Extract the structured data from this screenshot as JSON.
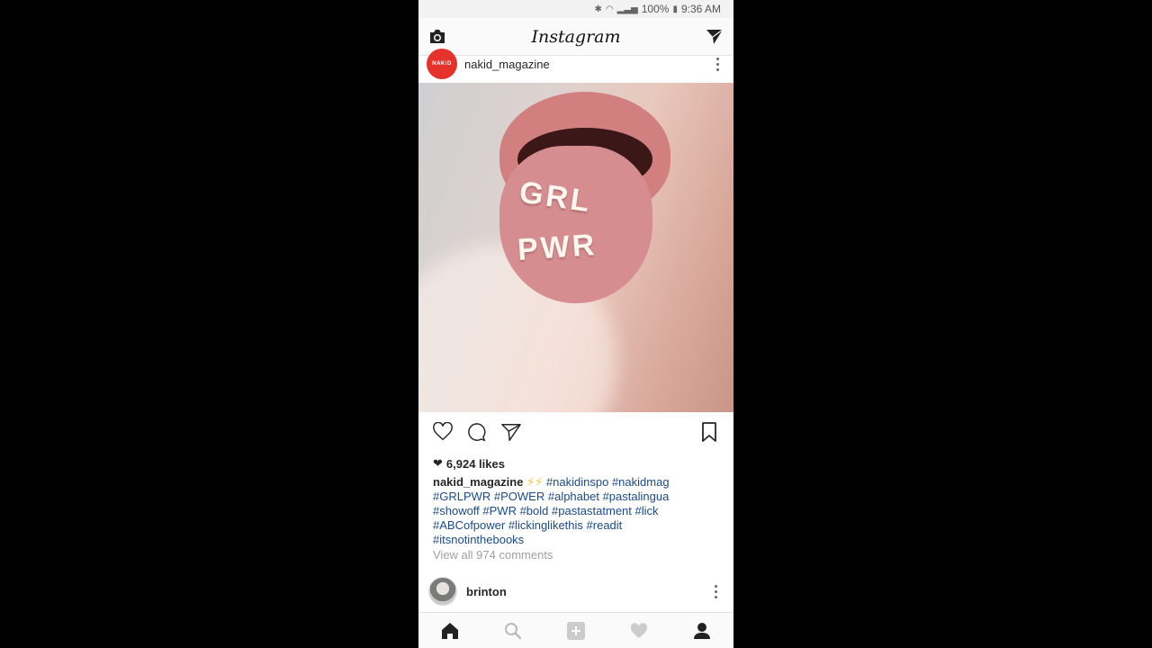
{
  "status_bar": {
    "battery": "100%",
    "time": "9:36 AM"
  },
  "app": {
    "title": "Instagram"
  },
  "post": {
    "username": "nakid_magazine",
    "avatar_text": "NAKID",
    "image_text_line1": "GRL",
    "image_text_line2": "PWR",
    "likes": "6,924 likes",
    "caption_user": "nakid_magazine",
    "caption_emoji": "⚡⚡",
    "caption_tags_1": "#nakidinspo #nakidmag",
    "caption_tags_2": "#GRLPWR #POWER #alphabet #pastalingua",
    "caption_tags_3": "#showoff #PWR #bold #pastastatment #lick",
    "caption_tags_4": "#ABCofpower #lickinglikethis #readit",
    "caption_tags_5": "#itsnotinthebooks",
    "view_comments": "View all 974 comments"
  },
  "next_post": {
    "username": "brinton"
  },
  "icons": {
    "camera": "camera-icon",
    "direct": "direct-message-icon",
    "heart": "heart-icon",
    "comment": "comment-icon",
    "share": "share-icon",
    "bookmark": "bookmark-icon",
    "home": "home-icon",
    "search": "search-icon",
    "add": "add-icon",
    "activity": "activity-icon",
    "profile": "profile-icon"
  },
  "colors": {
    "hashtag": "#1b4b8a",
    "brand_avatar": "#e5322b",
    "muted": "#a0a0a0"
  }
}
